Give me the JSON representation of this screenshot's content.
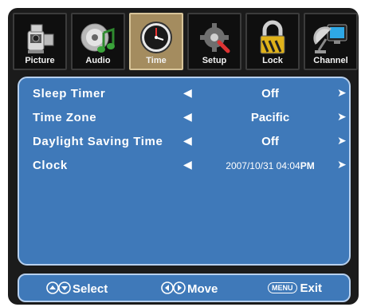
{
  "tabs": [
    {
      "label": "Picture",
      "icon": "camcorder-icon",
      "active": false
    },
    {
      "label": "Audio",
      "icon": "audio-disc-icon",
      "active": false
    },
    {
      "label": "Time",
      "icon": "clock-icon",
      "active": true
    },
    {
      "label": "Setup",
      "icon": "setup-gear-icon",
      "active": false
    },
    {
      "label": "Lock",
      "icon": "lock-icon",
      "active": false
    },
    {
      "label": "Channel",
      "icon": "satellite-dish-icon",
      "active": false
    }
  ],
  "settings": [
    {
      "name": "Sleep Timer",
      "value": "Off"
    },
    {
      "name": "Time Zone",
      "value": "Pacific"
    },
    {
      "name": "Daylight Saving Time",
      "value": "Off"
    },
    {
      "name": "Clock",
      "value": "2007/10/31 04:04",
      "suffix": "PM"
    }
  ],
  "footer": {
    "select_label": "Select",
    "move_label": "Move",
    "menu_key": "MENU",
    "exit_label": "Exit"
  },
  "colors": {
    "panel": "#3f79b9",
    "active_tab": "#a48c5f",
    "frame": "#1b1b1b"
  }
}
